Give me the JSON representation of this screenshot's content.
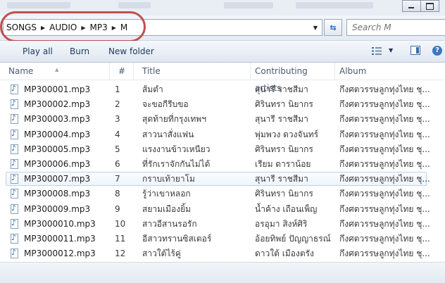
{
  "address": {
    "crumbs": [
      "SONGS",
      "AUDIO",
      "MP3",
      "M"
    ]
  },
  "search": {
    "placeholder": "Search M"
  },
  "toolbar": {
    "play_all": "Play all",
    "burn": "Burn",
    "new_folder": "New folder"
  },
  "columns": {
    "name": "Name",
    "number": "#",
    "title": "Title",
    "artists": "Contributing artists",
    "album": "Album"
  },
  "files": [
    {
      "name": "MP300001.mp3",
      "num": "1",
      "title": "ส้มตำ",
      "artist": "สุนารี ราชสีมา",
      "album": "กึงศตวรรษลูกทุ่งไทย ชุ..."
    },
    {
      "name": "MP300002.mp3",
      "num": "2",
      "title": "จะขอกีรีบขอ",
      "artist": "ศิรินทรา นิยากร",
      "album": "กึงศตวรรษลูกทุ่งไทย ชุ..."
    },
    {
      "name": "MP300003.mp3",
      "num": "3",
      "title": "สุดท้ายที่กรุงเทพฯ",
      "artist": "สุนารี ราชสีมา",
      "album": "กึงศตวรรษลูกทุ่งไทย ชุ..."
    },
    {
      "name": "MP300004.mp3",
      "num": "4",
      "title": "สาวนาสั่งแฟน",
      "artist": "พุ่มพวง ดวงจันทร์",
      "album": "กึงศตวรรษลูกทุ่งไทย ชุ..."
    },
    {
      "name": "MP300005.mp3",
      "num": "5",
      "title": "แรงงานข้าวเหนียว",
      "artist": "ศิรินทรา นิยากร",
      "album": "กึงศตวรรษลูกทุ่งไทย ชุ..."
    },
    {
      "name": "MP300006.mp3",
      "num": "6",
      "title": "ที่รักเราจักกันไม่ได้",
      "artist": "เรียม ดาราน้อย",
      "album": "กึงศตวรรษลูกทุ่งไทย ชุ..."
    },
    {
      "name": "MP300007.mp3",
      "num": "7",
      "title": "กราบเท้ายาโม",
      "artist": "สุนารี ราชสีมา",
      "album": "กึงศตวรรษลูกทุ่งไทย ชุ..."
    },
    {
      "name": "MP300008.mp3",
      "num": "8",
      "title": "รู้ว่าเขาหลอก",
      "artist": "ศิรินทรา นิยากร",
      "album": "กึงศตวรรษลูกทุ่งไทย ชุ..."
    },
    {
      "name": "MP300009.mp3",
      "num": "9",
      "title": "สยามเมืองยิ้ม",
      "artist": "น้ำค้าง เถือนเพ็ญ",
      "album": "กึงศตวรรษลูกทุ่งไทย ชุ..."
    },
    {
      "name": "MP3000010.mp3",
      "num": "10",
      "title": "สาวอีสานรอรัก",
      "artist": "อรอุมา สิงห์ศิริ",
      "album": "กึงศตวรรษลูกทุ่งไทย ชุ..."
    },
    {
      "name": "MP3000011.mp3",
      "num": "11",
      "title": "อีสาวทรานซิสเตอร์",
      "artist": "อ้อยทิพย์ ปัญญาธรณ์",
      "album": "กึงศตวรรษลูกทุ่งไทย ชุ..."
    },
    {
      "name": "MP3000012.mp3",
      "num": "12",
      "title": "สาวใต้ไร้คู่",
      "artist": "ดาวใต้ เมืองตรัง",
      "album": "กึงศตวรรษลูกทุ่งไทย ชุ..."
    }
  ],
  "selected_index": 6,
  "colors": {
    "highlight_ring": "#c0504d",
    "selection_border": "#b8d2ef",
    "command_text": "#1e395b"
  }
}
